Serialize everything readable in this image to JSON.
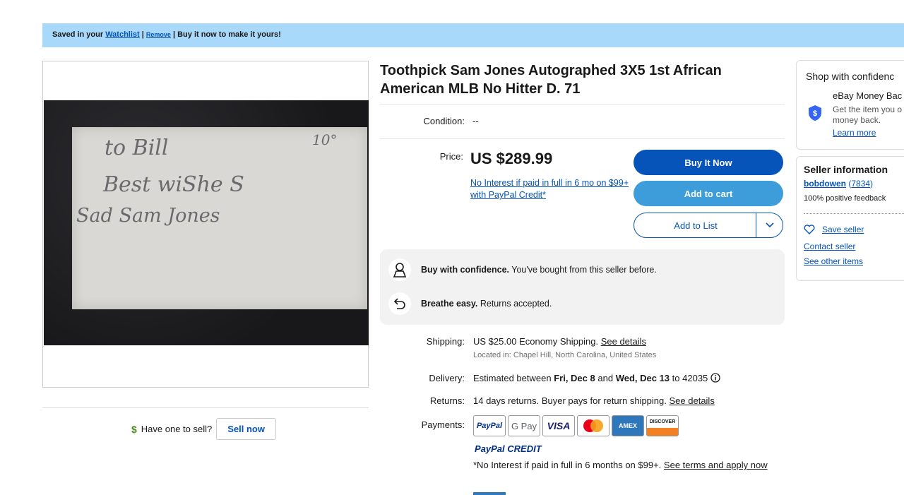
{
  "banner": {
    "saved_prefix": "Saved in your",
    "watchlist_link": "Watchlist",
    "sep1": "|",
    "remove_link": "Remove",
    "suffix": "| Buy it now to make it yours!"
  },
  "photo": {
    "line1": "to Bill",
    "line2": "Best wiShe S",
    "line3": "Sad Sam Jones",
    "corner": "10°"
  },
  "sell": {
    "prompt": "Have one to sell?",
    "button": "Sell now"
  },
  "listing": {
    "title": "Toothpick Sam Jones Autographed 3X5 1st African American MLB No Hitter D. 71",
    "condition_label": "Condition:",
    "condition_value": "--",
    "price_label": "Price:",
    "price": "US $289.99",
    "credit_offer": "No Interest if paid in full in 6 mo on $99+ with PayPal Credit*"
  },
  "buttons": {
    "buy_now": "Buy It Now",
    "add_to_cart": "Add to cart",
    "add_to_list": "Add to List"
  },
  "confidence": [
    {
      "bold": "Buy with confidence.",
      "text": "You've bought from this seller before."
    },
    {
      "bold": "Breathe easy.",
      "text": "Returns accepted."
    }
  ],
  "shipping": {
    "label": "Shipping:",
    "cost": "US $25.00",
    "method": "Economy Shipping.",
    "details_link": "See details",
    "location": "Located in: Chapel Hill, North Carolina, United States"
  },
  "delivery": {
    "label": "Delivery:",
    "prefix": "Estimated between",
    "start": "Fri, Dec 8",
    "and": "and",
    "end": "Wed, Dec 13",
    "to": "to 42035"
  },
  "returns": {
    "label": "Returns:",
    "text": "14 days returns. Buyer pays for return shipping.",
    "details_link": "See details"
  },
  "payments": {
    "label": "Payments:",
    "methods": [
      "PayPal",
      "G Pay",
      "VISA",
      "Mastercard",
      "AMEX",
      "DISCOVER"
    ],
    "paypal_credit": "PayPal CREDIT",
    "note": "*No Interest if paid in full in 6 months on $99+.",
    "terms_link": "See terms and apply now"
  },
  "shop_confidence": {
    "title": "Shop with confidenc",
    "guarantee_title": "eBay Money Bac",
    "guarantee_text_1": "Get the item you o",
    "guarantee_text_2": "money back.",
    "learn_more": "Learn more"
  },
  "seller": {
    "title": "Seller information",
    "name": "bobdowen",
    "score": "7834",
    "feedback": "100% positive feedback",
    "save_seller": "Save seller",
    "contact": "Contact seller",
    "other_items": "See other items"
  },
  "colors": {
    "link": "#0654ba",
    "buy_button": "#0654ba",
    "cart_button": "#3d9ddb",
    "banner": "#a8d8fa"
  }
}
